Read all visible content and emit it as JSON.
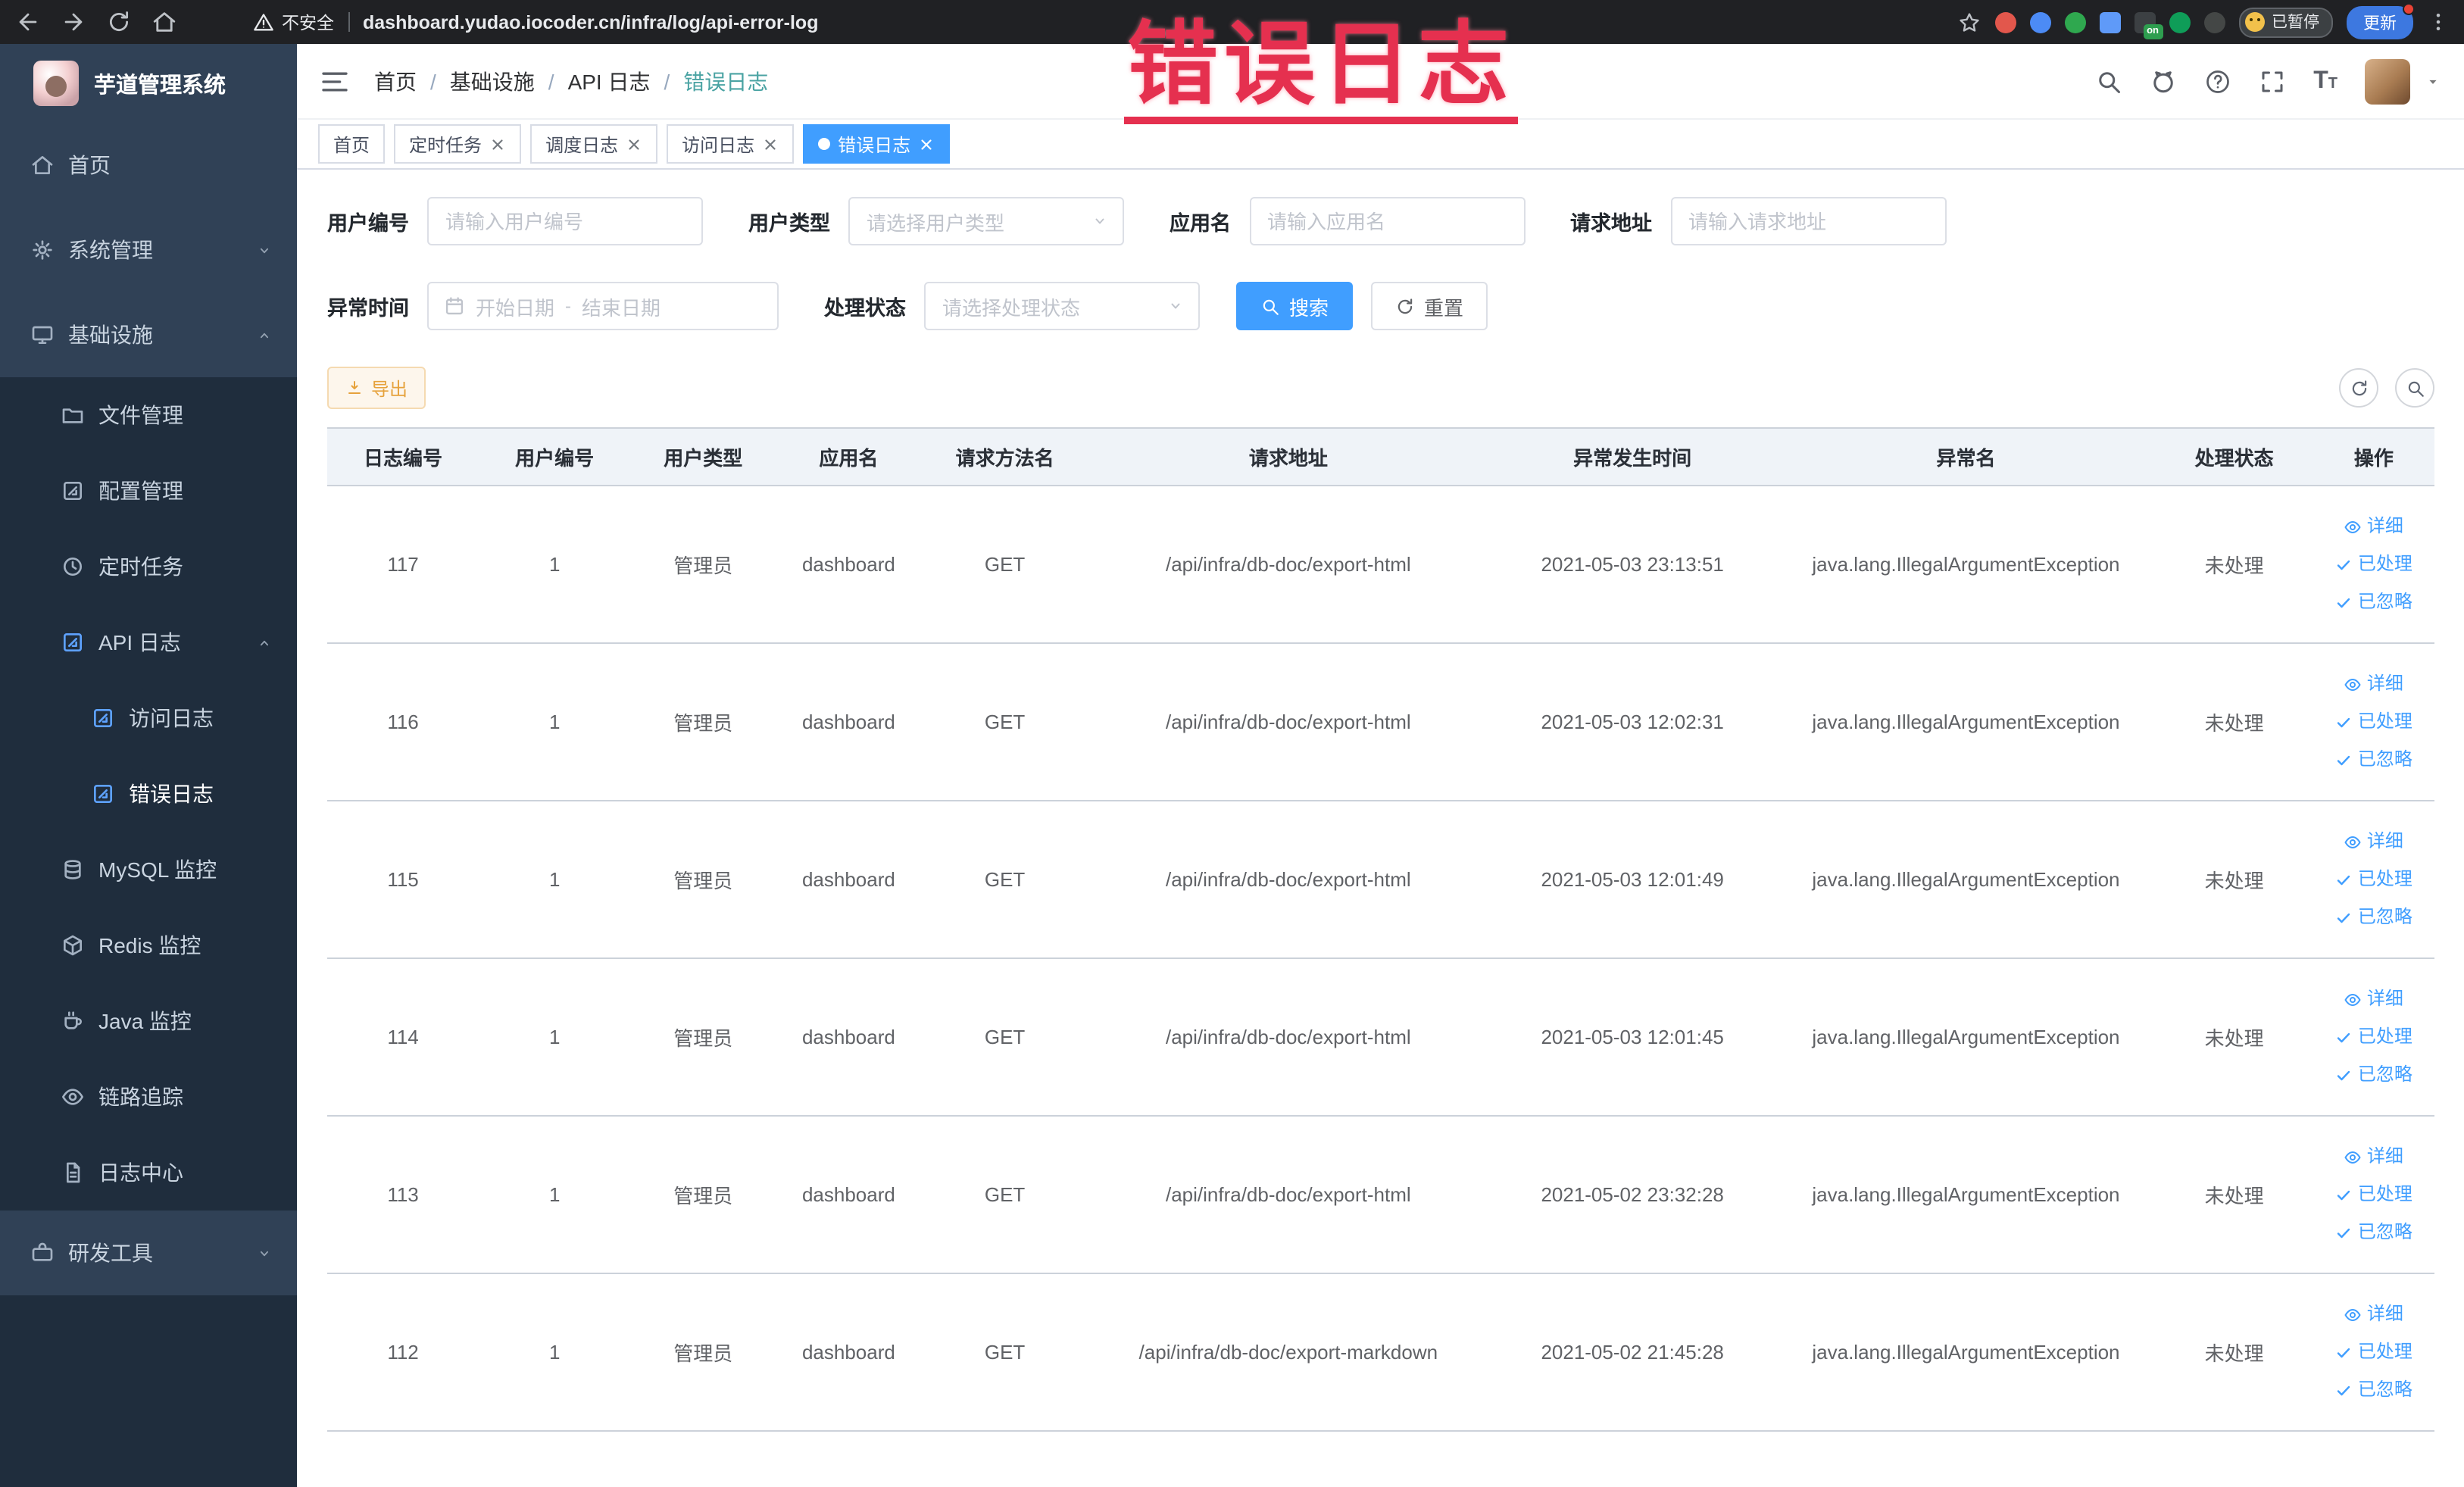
{
  "watermark": "错误日志",
  "browser": {
    "security_label": "不安全",
    "url": "dashboard.yudao.iocoder.cn/infra/log/api-error-log",
    "paused_badge": "已暂停",
    "update_label": "更新",
    "ext_on_badge": "on"
  },
  "sidebar": {
    "logo_title": "芋道管理系统",
    "home": "首页",
    "system": "系统管理",
    "infra": "基础设施",
    "file": "文件管理",
    "config": "配置管理",
    "job": "定时任务",
    "api_log": "API 日志",
    "access_log": "访问日志",
    "error_log": "错误日志",
    "mysql": "MySQL 监控",
    "redis": "Redis 监控",
    "java": "Java 监控",
    "trace": "链路追踪",
    "log_center": "日志中心",
    "dev_tools": "研发工具"
  },
  "breadcrumb": {
    "items": [
      "首页",
      "基础设施",
      "API 日志",
      "错误日志"
    ],
    "separator": "/"
  },
  "tabs": [
    {
      "label": "首页"
    },
    {
      "label": "定时任务"
    },
    {
      "label": "调度日志"
    },
    {
      "label": "访问日志"
    },
    {
      "label": "错误日志"
    }
  ],
  "filters": {
    "user_id": {
      "label": "用户编号",
      "placeholder": "请输入用户编号"
    },
    "user_type": {
      "label": "用户类型",
      "placeholder": "请选择用户类型"
    },
    "app_name": {
      "label": "应用名",
      "placeholder": "请输入应用名"
    },
    "request_url": {
      "label": "请求地址",
      "placeholder": "请输入请求地址"
    },
    "exception_time": {
      "label": "异常时间",
      "start_placeholder": "开始日期",
      "separator": "-",
      "end_placeholder": "结束日期"
    },
    "process_status": {
      "label": "处理状态",
      "placeholder": "请选择处理状态"
    },
    "search_label": "搜索",
    "reset_label": "重置"
  },
  "toolbar": {
    "export_label": "导出"
  },
  "table": {
    "columns": [
      "日志编号",
      "用户编号",
      "用户类型",
      "应用名",
      "请求方法名",
      "请求地址",
      "异常发生时间",
      "异常名",
      "处理状态",
      "操作"
    ],
    "actions": {
      "detail": "详细",
      "process": "已处理",
      "ignore": "已忽略"
    },
    "rows": [
      {
        "id": "117",
        "user_id": "1",
        "user_type": "管理员",
        "app": "dashboard",
        "method": "GET",
        "url": "/api/infra/db-doc/export-html",
        "time": "2021-05-03 23:13:51",
        "exception": "java.lang.IllegalArgumentException",
        "status": "未处理"
      },
      {
        "id": "116",
        "user_id": "1",
        "user_type": "管理员",
        "app": "dashboard",
        "method": "GET",
        "url": "/api/infra/db-doc/export-html",
        "time": "2021-05-03 12:02:31",
        "exception": "java.lang.IllegalArgumentException",
        "status": "未处理"
      },
      {
        "id": "115",
        "user_id": "1",
        "user_type": "管理员",
        "app": "dashboard",
        "method": "GET",
        "url": "/api/infra/db-doc/export-html",
        "time": "2021-05-03 12:01:49",
        "exception": "java.lang.IllegalArgumentException",
        "status": "未处理"
      },
      {
        "id": "114",
        "user_id": "1",
        "user_type": "管理员",
        "app": "dashboard",
        "method": "GET",
        "url": "/api/infra/db-doc/export-html",
        "time": "2021-05-03 12:01:45",
        "exception": "java.lang.IllegalArgumentException",
        "status": "未处理"
      },
      {
        "id": "113",
        "user_id": "1",
        "user_type": "管理员",
        "app": "dashboard",
        "method": "GET",
        "url": "/api/infra/db-doc/export-html",
        "time": "2021-05-02 23:32:28",
        "exception": "java.lang.IllegalArgumentException",
        "status": "未处理"
      },
      {
        "id": "112",
        "user_id": "1",
        "user_type": "管理员",
        "app": "dashboard",
        "method": "GET",
        "url": "/api/infra/db-doc/export-markdown",
        "time": "2021-05-02 21:45:28",
        "exception": "java.lang.IllegalArgumentException",
        "status": "未处理"
      }
    ]
  }
}
